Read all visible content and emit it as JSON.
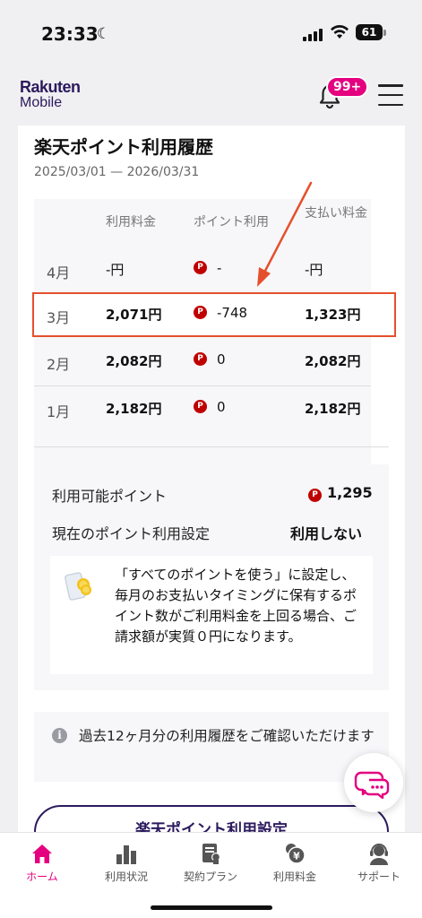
{
  "status_bar": {
    "time": "23:33",
    "battery": "61"
  },
  "header": {
    "logo_top": "Rakuten",
    "logo_bottom": "Mobile",
    "badge": "99+"
  },
  "page": {
    "title": "楽天ポイント利用履歴",
    "date_range": "2025/03/01 — 2026/03/31"
  },
  "table": {
    "headers": {
      "fee": "利用料金",
      "points": "ポイント利用",
      "paid": "支払い料金"
    },
    "rows": [
      {
        "month": "4月",
        "fee": "-円",
        "points": "-",
        "paid": "-円"
      },
      {
        "month": "3月",
        "fee": "2,071円",
        "points": "-748",
        "paid": "1,323円"
      },
      {
        "month": "2月",
        "fee": "2,082円",
        "points": "0",
        "paid": "2,082円"
      },
      {
        "month": "1月",
        "fee": "2,182円",
        "points": "0",
        "paid": "2,182円"
      }
    ],
    "point_icon": "P"
  },
  "points": {
    "available_label": "利用可能ポイント",
    "available_value": "1,295",
    "setting_label": "現在のポイント利用設定",
    "setting_value": "利用しない",
    "info": "「すべてのポイントを使う」に設定し、毎月のお支払いタイミングに保有するポイント数がご利用料金を上回る場合、ご請求額が実質０円になります。"
  },
  "notice": {
    "icon": "i",
    "text": "過去12ヶ月分の利用履歴をご確認いただけます"
  },
  "button": {
    "label": "楽天ポイント利用設定"
  },
  "nav": {
    "items": [
      {
        "label": "ホーム",
        "icon": "home-icon"
      },
      {
        "label": "利用状況",
        "icon": "chart-icon"
      },
      {
        "label": "契約プラン",
        "icon": "contract-icon"
      },
      {
        "label": "利用料金",
        "icon": "yen-icon"
      },
      {
        "label": "サポート",
        "icon": "support-icon"
      }
    ],
    "active": "ホーム"
  },
  "colors": {
    "brand_pink": "#e4007f",
    "brand_navy": "#2b1a5e",
    "point_red": "#bf0000",
    "annotation": "#e5502c"
  }
}
